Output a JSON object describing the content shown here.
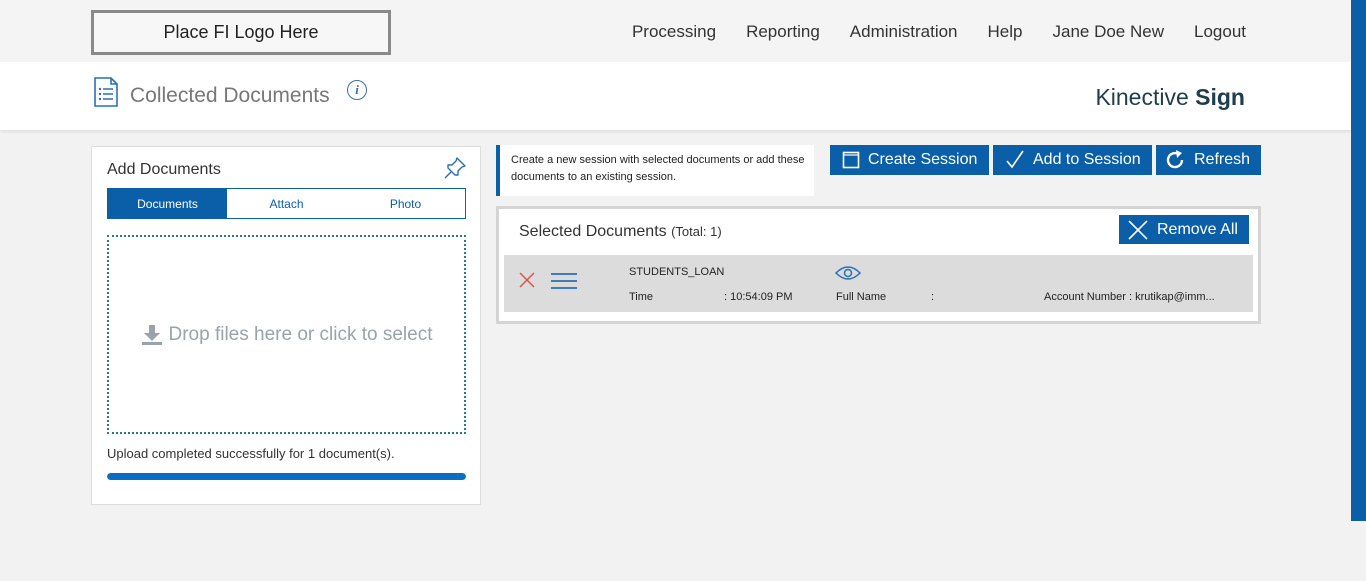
{
  "header": {
    "logo_text": "Place FI Logo Here",
    "nav": [
      "Processing",
      "Reporting",
      "Administration",
      "Help",
      "Jane Doe New",
      "Logout"
    ]
  },
  "page": {
    "title": "Collected Documents",
    "info_icon": "i",
    "brand_light": "Kinective ",
    "brand_bold": "Sign"
  },
  "add_panel": {
    "title": "Add Documents",
    "tabs": [
      "Documents",
      "Attach",
      "Photo"
    ],
    "active_tab": "Documents",
    "dropzone_text": "Drop files here or click to select",
    "upload_message": "Upload completed successfully for 1 document(s).",
    "progress_percent": 100
  },
  "note": {
    "text": "Create a new session with selected documents or add these documents to an existing session."
  },
  "actions": {
    "create_session": "Create Session",
    "add_to_session": "Add to Session",
    "refresh": "Refresh"
  },
  "selected": {
    "title": "Selected Documents",
    "total_label": "(Total: 1)",
    "remove_all": "Remove All",
    "rows": [
      {
        "doc_name": "STUDENTS_LOAN",
        "time_label": "Time",
        "time_value": ": 10:54:09 PM",
        "fullname_label": "Full Name",
        "fullname_value": ":",
        "account": "Account Number : krutikap@imm..."
      }
    ]
  },
  "colors": {
    "primary": "#0a5fa8",
    "brand_text": "#1f3d4a",
    "delete_red": "#d9534f"
  }
}
